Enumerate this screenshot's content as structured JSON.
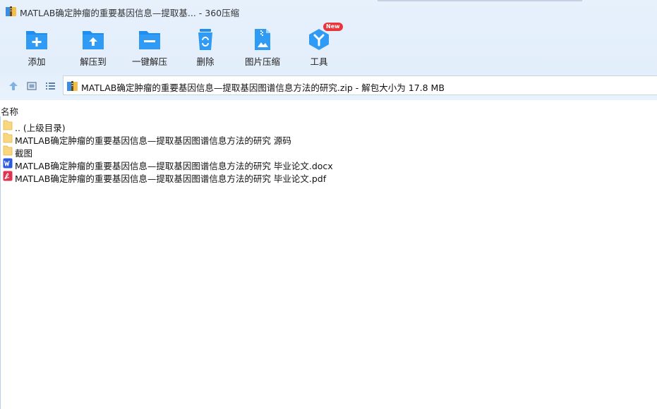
{
  "window": {
    "title": "MATLAB确定肿瘤的重要基因信息—提取基... - 360压缩"
  },
  "toolbar": {
    "buttons": [
      {
        "label": "添加",
        "icon": "add-icon"
      },
      {
        "label": "解压到",
        "icon": "extract-to-icon"
      },
      {
        "label": "一键解压",
        "icon": "one-click-extract-icon"
      },
      {
        "label": "删除",
        "icon": "delete-icon"
      },
      {
        "label": "图片压缩",
        "icon": "image-compress-icon"
      },
      {
        "label": "工具",
        "icon": "tools-icon",
        "badge": "New"
      }
    ]
  },
  "navigation": {
    "icons": [
      "up-arrow-icon",
      "thumbnail-view-icon",
      "list-view-icon"
    ]
  },
  "address": {
    "path": "MATLAB确定肿瘤的重要基因信息—提取基因图谱信息方法的研究.zip - 解包大小为 17.8 MB"
  },
  "columns": {
    "name": "名称"
  },
  "files": [
    {
      "name": ".. (上级目录)",
      "type": "folder"
    },
    {
      "name": "MATLAB确定肿瘤的重要基因信息—提取基因图谱信息方法的研究 源码",
      "type": "folder"
    },
    {
      "name": "截图",
      "type": "folder"
    },
    {
      "name": "MATLAB确定肿瘤的重要基因信息—提取基因图谱信息方法的研究 毕业论文.docx",
      "type": "word"
    },
    {
      "name": "MATLAB确定肿瘤的重要基因信息—提取基因图谱信息方法的研究 毕业论文.pdf",
      "type": "pdf"
    }
  ],
  "colors": {
    "accent": "#1e8ef0",
    "toolbar_bg": "#e4effb",
    "badge": "#e8363c",
    "folder": "#f9d77e",
    "word": "#2b5ae0",
    "pdf": "#e0334f"
  }
}
